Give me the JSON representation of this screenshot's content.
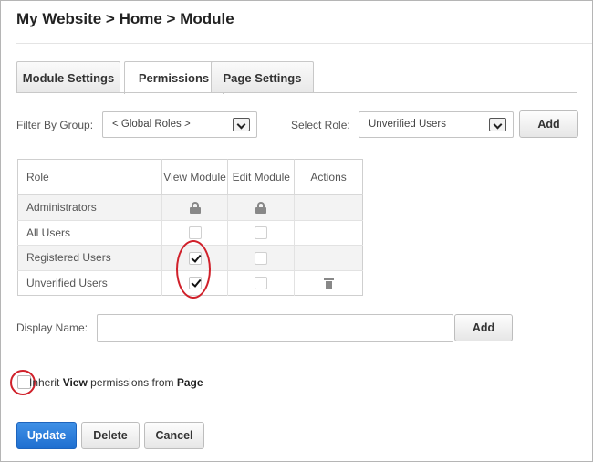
{
  "breadcrumb": "My Website > Home > Module",
  "tabs": [
    {
      "label": "Module Settings",
      "active": false
    },
    {
      "label": "Permissions",
      "active": true
    },
    {
      "label": "Page Settings",
      "active": false
    }
  ],
  "filter": {
    "label": "Filter By Group:",
    "value": "< Global Roles >"
  },
  "role_select": {
    "label": "Select Role:",
    "value": "Unverified Users"
  },
  "add_role_button": "Add",
  "grid": {
    "headers": {
      "role": "Role",
      "view_module": "View Module",
      "edit_module": "Edit Module",
      "actions": "Actions"
    },
    "rows": [
      {
        "role": "Administrators",
        "view": "locked",
        "edit": "locked",
        "action": ""
      },
      {
        "role": "All Users",
        "view": "unchecked",
        "edit": "unchecked",
        "action": ""
      },
      {
        "role": "Registered Users",
        "view": "checked",
        "edit": "unchecked",
        "action": ""
      },
      {
        "role": "Unverified Users",
        "view": "checked",
        "edit": "unchecked",
        "action": "trash-icon"
      }
    ]
  },
  "display_name": {
    "label": "Display Name:",
    "value": "",
    "placeholder": ""
  },
  "add_user_button": "Add",
  "inherit": {
    "prefix": "Inherit ",
    "bold1": "View",
    "middle": " permissions from ",
    "bold2": "Page",
    "checked": false
  },
  "actions": {
    "update": "Update",
    "delete": "Delete",
    "cancel": "Cancel"
  },
  "colors": {
    "primary_button": "#2a7fdc",
    "highlight_circle": "#d0202a"
  }
}
